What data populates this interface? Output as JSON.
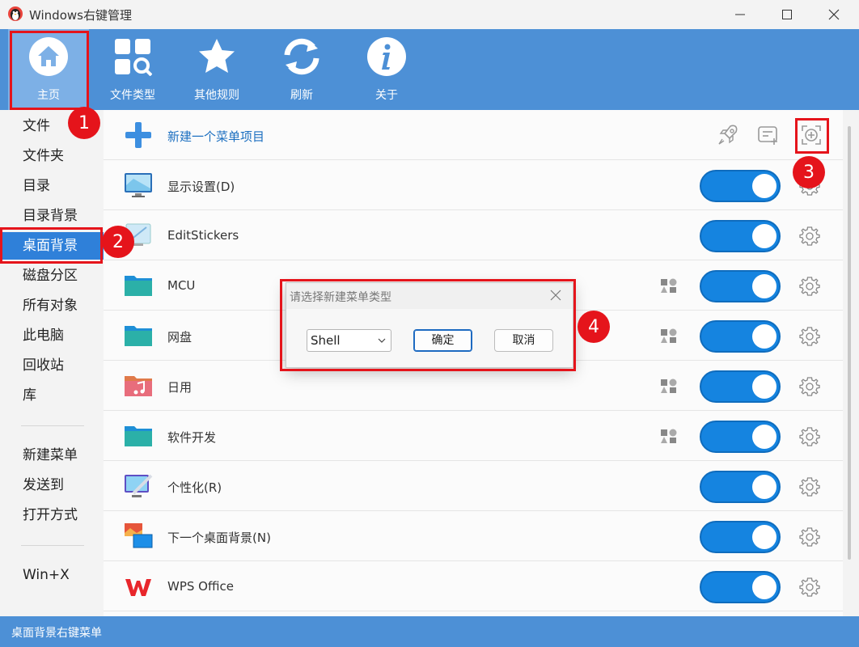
{
  "window": {
    "title": "Windows右键管理"
  },
  "toolbar": {
    "items": [
      {
        "label": "主页"
      },
      {
        "label": "文件类型"
      },
      {
        "label": "其他规则"
      },
      {
        "label": "刷新"
      },
      {
        "label": "关于"
      }
    ]
  },
  "sidebar": {
    "items": [
      {
        "label": "文件"
      },
      {
        "label": "文件夹"
      },
      {
        "label": "目录"
      },
      {
        "label": "目录背景"
      },
      {
        "label": "桌面背景"
      },
      {
        "label": "磁盘分区"
      },
      {
        "label": "所有对象"
      },
      {
        "label": "此电脑"
      },
      {
        "label": "回收站"
      },
      {
        "label": "库"
      },
      {
        "label": "新建菜单"
      },
      {
        "label": "发送到"
      },
      {
        "label": "打开方式"
      },
      {
        "label": "Win+X"
      }
    ],
    "selected": "桌面背景"
  },
  "main": {
    "new_item_label": "新建一个菜单项目",
    "rows": [
      {
        "label": "显示设置(D)",
        "enabled": true
      },
      {
        "label": "EditStickers",
        "enabled": true
      },
      {
        "label": "MCU",
        "enabled": true
      },
      {
        "label": "网盘",
        "enabled": true
      },
      {
        "label": "日用",
        "enabled": true
      },
      {
        "label": "软件开发",
        "enabled": true
      },
      {
        "label": "个性化(R)",
        "enabled": true
      },
      {
        "label": "下一个桌面背景(N)",
        "enabled": true
      },
      {
        "label": "WPS Office",
        "enabled": true
      }
    ]
  },
  "dialog": {
    "title": "请选择新建菜单类型",
    "select_value": "Shell",
    "ok_label": "确定",
    "cancel_label": "取消"
  },
  "annotations": {
    "b1": "1",
    "b2": "2",
    "b3": "3",
    "b4": "4"
  },
  "statusbar": {
    "text": "桌面背景右键菜单"
  },
  "colors": {
    "accent": "#4d90d6",
    "toggle": "#1584e0",
    "selected": "#2f80d9",
    "annotation": "#e5141b"
  }
}
